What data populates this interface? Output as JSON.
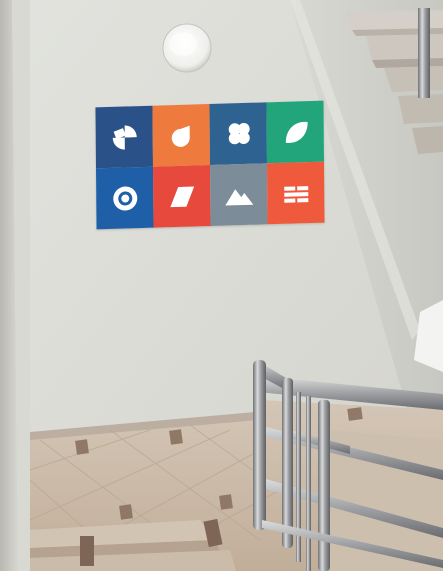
{
  "scene": {
    "description_kind": "photo",
    "colors": {
      "wall": "#dcdcd6",
      "wall_shadow": "#c9c8c1",
      "ceiling_light": "#f4f4f2",
      "floor_tile": "#c9b9a6",
      "floor_dark": "#8a7160",
      "railing": "#a7a9ab"
    }
  },
  "artwork": {
    "tiles": [
      {
        "color": "#2b5189",
        "icon": "pinwheel-icon"
      },
      {
        "color": "#ee7a3d",
        "icon": "leaf-drop-icon"
      },
      {
        "color": "#2e6290",
        "icon": "flower-icon"
      },
      {
        "color": "#22a57b",
        "icon": "leaf-icon"
      },
      {
        "color": "#1f5fa8",
        "icon": "target-icon"
      },
      {
        "color": "#e8493d",
        "icon": "parallelogram-icon"
      },
      {
        "color": "#7d8c99",
        "icon": "mountain-icon"
      },
      {
        "color": "#ef5a3d",
        "icon": "bricks-icon"
      }
    ]
  }
}
